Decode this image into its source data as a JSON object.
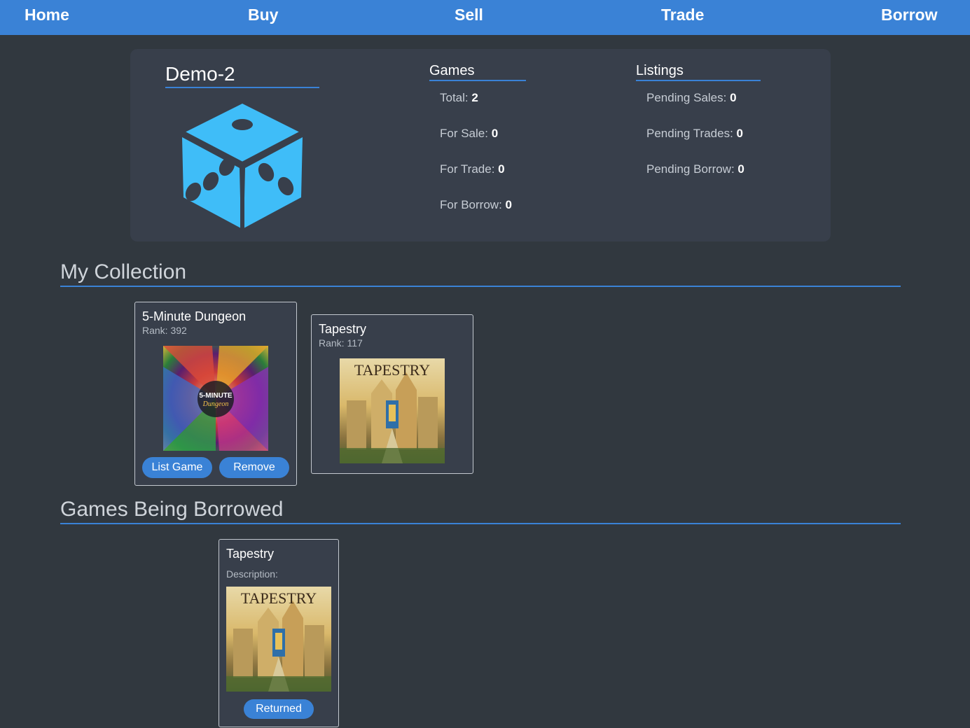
{
  "nav": {
    "home": "Home",
    "buy": "Buy",
    "sell": "Sell",
    "trade": "Trade",
    "borrow": "Borrow"
  },
  "profile": {
    "username": "Demo-2",
    "avatar_icon": "dice-icon",
    "games": {
      "heading": "Games",
      "total_label": "Total:",
      "total_value": "2",
      "for_sale_label": "For Sale:",
      "for_sale_value": "0",
      "for_trade_label": "For Trade:",
      "for_trade_value": "0",
      "for_borrow_label": "For Borrow:",
      "for_borrow_value": "0"
    },
    "listings": {
      "heading": "Listings",
      "pending_sales_label": "Pending Sales:",
      "pending_sales_value": "0",
      "pending_trades_label": "Pending Trades:",
      "pending_trades_value": "0",
      "pending_borrow_label": "Pending Borrow:",
      "pending_borrow_value": "0"
    }
  },
  "collection": {
    "heading": "My Collection",
    "items": [
      {
        "title": "5-Minute Dungeon",
        "rank": "Rank: 392",
        "art_label": "5-MINUTE Dungeon",
        "list_button": "List Game",
        "remove_button": "Remove"
      },
      {
        "title": "Tapestry",
        "rank": "Rank: 117",
        "art_label": "TAPESTRY"
      }
    ]
  },
  "borrowed": {
    "heading": "Games Being Borrowed",
    "items": [
      {
        "title": "Tapestry",
        "description": "Description:",
        "art_label": "TAPESTRY",
        "returned_button": "Returned"
      }
    ]
  },
  "colors": {
    "accent": "#3a82d6",
    "background": "#31383f",
    "card": "#383f4b",
    "dice": "#3fbdf8"
  }
}
